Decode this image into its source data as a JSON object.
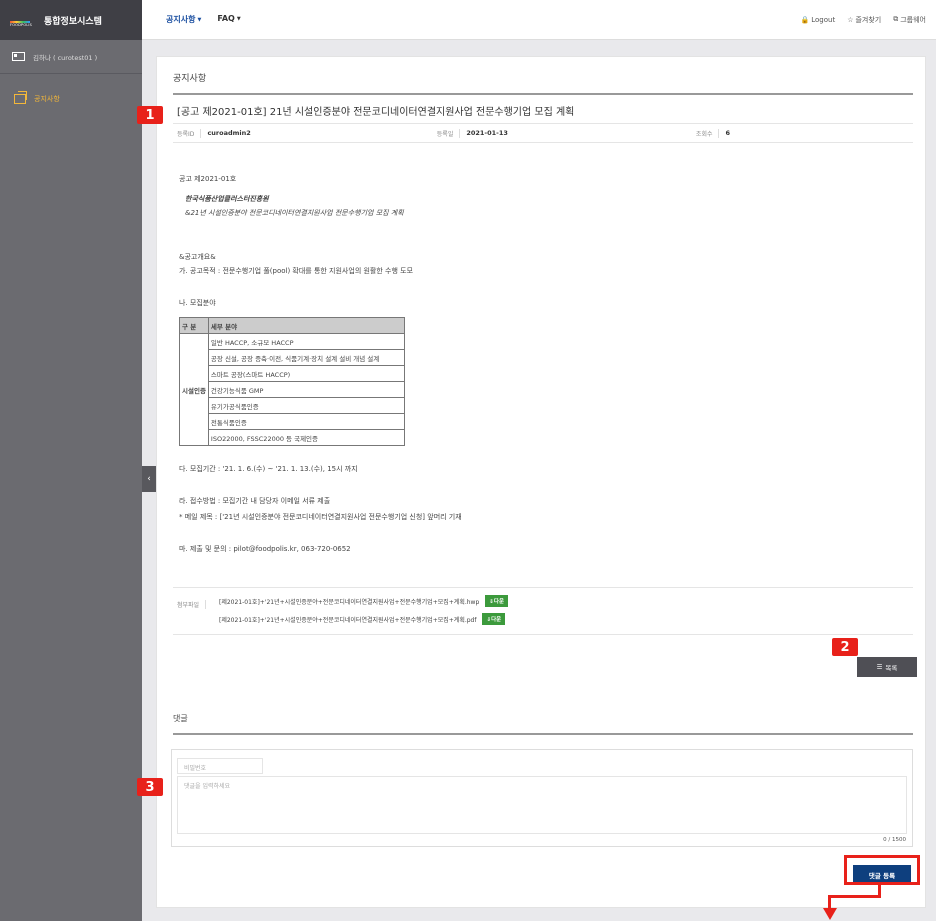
{
  "sidebar": {
    "logo_text": "FOODPOLIS",
    "title": "통합정보시스템",
    "user": "김하나 ( curotest01 )",
    "menu_item": "공지사항"
  },
  "topbar": {
    "nav": [
      {
        "label": "공지사항"
      },
      {
        "label": "FAQ"
      }
    ],
    "logout": "Logout",
    "favorites": "즐겨찾기",
    "groupware": "그룹웨어"
  },
  "page": {
    "section_title": "공지사항",
    "notice_title": "[공고 제2021-01호] 21년 시설인증분야 전문코디네이터연결지원사업 전문수행기업 모집 계획",
    "meta": {
      "author_label": "등록ID",
      "author": "curoadmin2",
      "date_label": "등록일",
      "date": "2021-01-13",
      "views_label": "조회수",
      "views": "6"
    },
    "body": {
      "l1": "공고 제2021-01호",
      "l2": "한국식품산업클러스터진흥원",
      "l3": "&21년 시설인증분야 전문코디네이터연결지원사업 전문수행기업 모집 계획",
      "l4": "&공고개요&",
      "l5": "가. 공고목적 : 전문수행기업 풀(pool) 확대를 통한 지원사업의 원활한 수행 도모",
      "l6": "나. 모집분야",
      "l7": "다. 모집기간 : '21. 1. 6.(수) ~ '21. 1. 13.(수), 15시 까지",
      "l8": "라. 접수방법 : 모집기간 내 담당자 이메일 서류 제출",
      "l9": "* 메일 제목 : ['21년 시설인증분야 전문코디네이터연결지원사업 전문수행기업 신청] 앞머리 기재",
      "l10": "마. 제출 및 문의 : pilot@foodpolis.kr, 063-720-0652"
    },
    "table": {
      "headers": [
        "구 분",
        "세부 분야"
      ],
      "category": "시설인증",
      "rows": [
        "일반 HACCP, 소규모 HACCP",
        "공장 신설, 공장 증축·이전, 식품기계·장치 설계 설비 개념 설계",
        "스마트 공장(스마트 HACCP)",
        "건강기능식품 GMP",
        "유기가공식품인증",
        "전통식품인증",
        "ISO22000, FSSC22000 등 국제인증"
      ]
    },
    "attachments": {
      "label": "첨부파일",
      "files": [
        {
          "name": "[제2021-01호]+'21년+시설인증분야+전문코디네이터연결지원사업+전문수행기업+모집+계획.hwp",
          "button": "다운"
        },
        {
          "name": "[제2021-01호]+'21년+시설인증분야+전문코디네이터연결지원사업+전문수행기업+모집+계획.pdf",
          "button": "다운"
        }
      ]
    },
    "list_button": "목록"
  },
  "comments": {
    "title": "댓글",
    "password_placeholder": "비밀번호",
    "textarea_placeholder": "댓글을 입력하세요",
    "counter": "0 / 1500",
    "submit": "댓글 등록"
  },
  "annotations": {
    "m1": "1",
    "m2": "2",
    "m3": "3",
    "color": "#e8211a"
  }
}
